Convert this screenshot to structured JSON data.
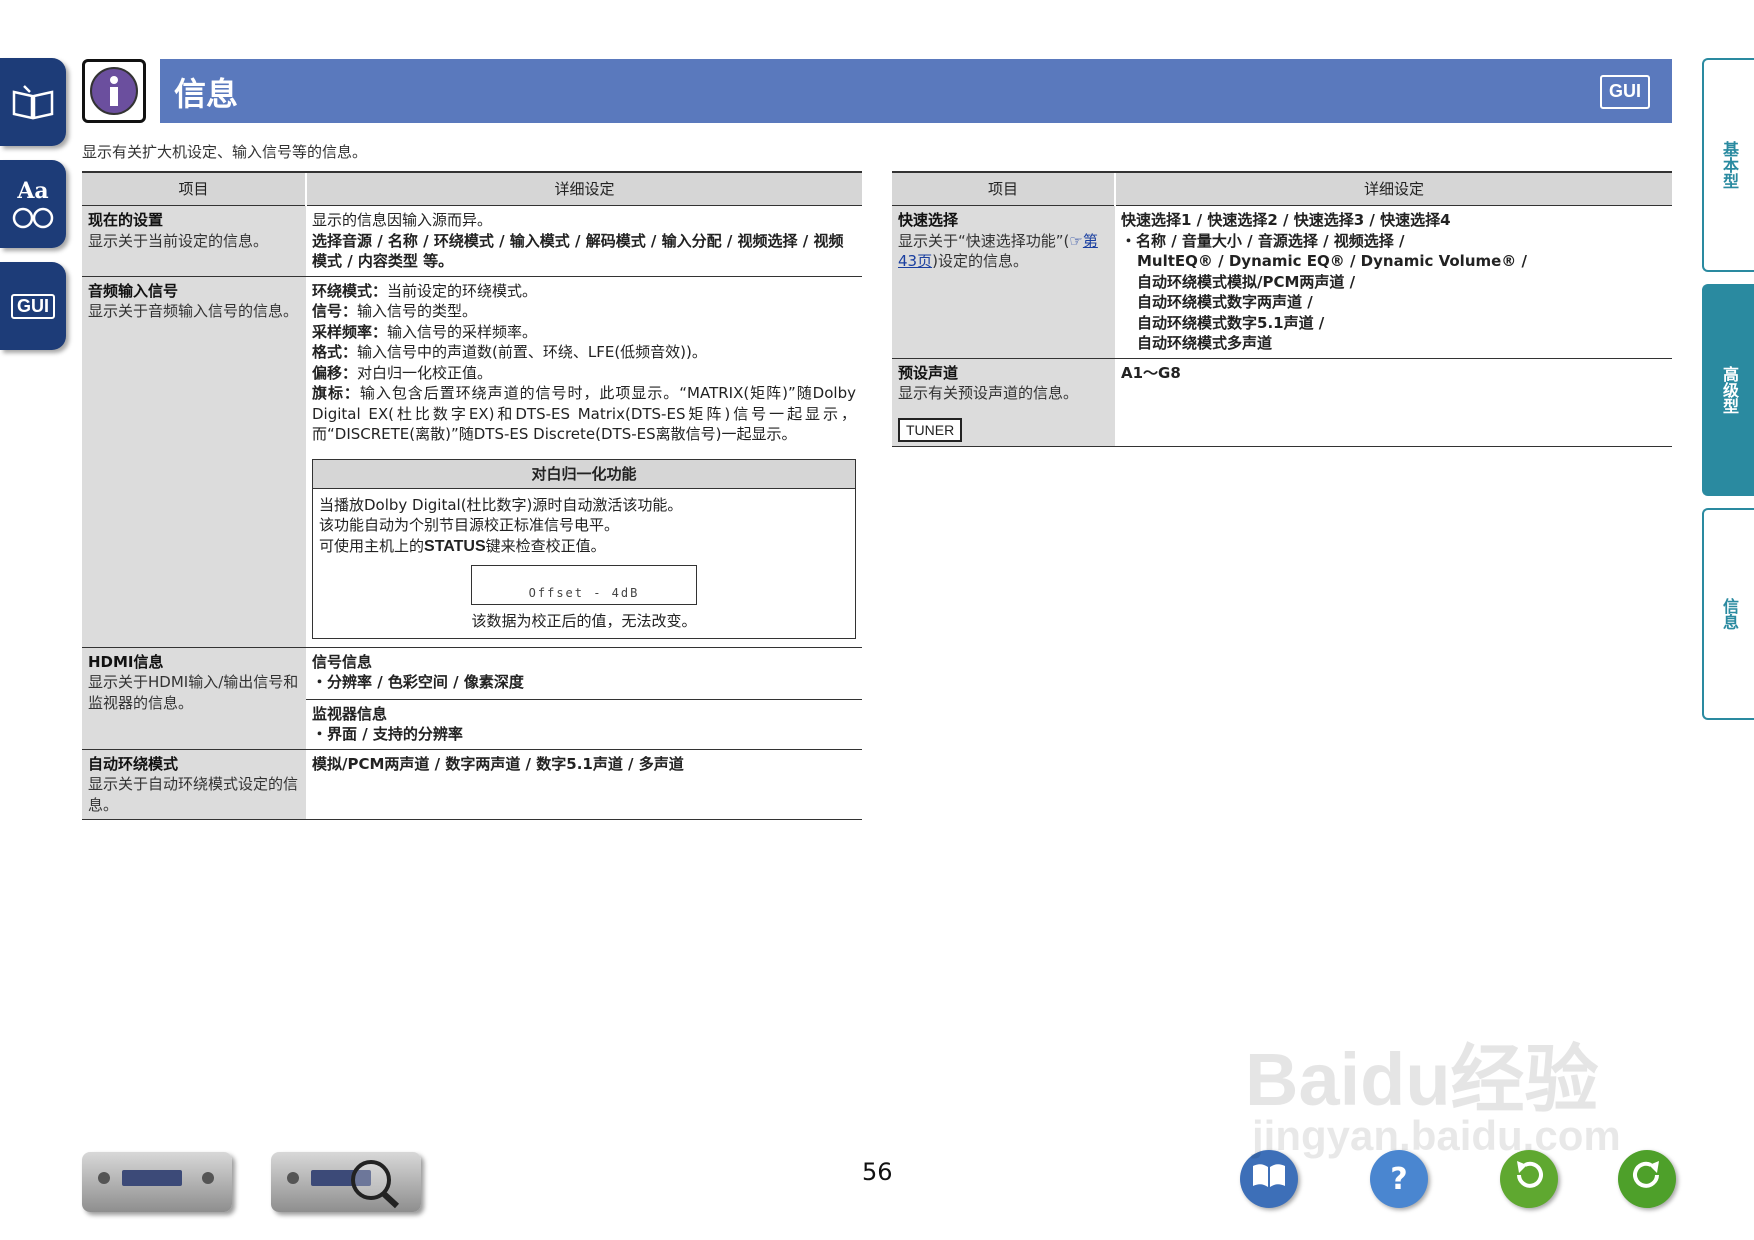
{
  "header": {
    "title": "信息",
    "gui_label": "GUI",
    "intro": "显示有关扩大机设定、输入信号等的信息。"
  },
  "left_tabs": [
    {
      "icon": "book-icon"
    },
    {
      "icon": "glossary-icon",
      "text": "Aa"
    },
    {
      "icon": "gui-icon",
      "text": "GUI"
    }
  ],
  "columns": {
    "item": "项目",
    "detail": "详细设定"
  },
  "left_table": {
    "rows": [
      {
        "name": "现在的设置",
        "desc": "显示关于当前设定的信息。",
        "detail_1": "显示的信息因输入源而异。",
        "detail_2": "选择音源 / 名称 / 环绕模式 / 输入模式 / 解码模式 / 输入分配 / 视频选择 / 视频模式 / 内容类型 等。"
      },
      {
        "name": "音频输入信号",
        "desc": "显示关于音频输入信号的信息。",
        "lines": [
          {
            "label": "环绕模式：",
            "text": "当前设定的环绕模式。"
          },
          {
            "label": "信号：",
            "text": "输入信号的类型。"
          },
          {
            "label": "采样频率：",
            "text": "输入信号的采样频率。"
          },
          {
            "label": "格式：",
            "text": "输入信号中的声道数(前置、环绕、LFE(低频音效))。"
          },
          {
            "label": "偏移：",
            "text": "对白归一化校正值。"
          },
          {
            "label": "旗标：",
            "text": "输入包含后置环绕声道的信号时，此项显示。“MATRIX(矩阵)”随Dolby Digital EX(杜比数字EX)和DTS-ES Matrix(DTS-ES矩阵)信号一起显示，而“DISCRETE(离散)”随DTS-ES Discrete(DTS-ES离散信号)一起显示。"
          }
        ],
        "dialogue_box": {
          "title": "对白归一化功能",
          "line_1": "当播放Dolby Digital(杜比数字)源时自动激活该功能。",
          "line_2": "该功能自动为个别节目源校正标准信号电平。",
          "line_3_pre": "可使用主机上的",
          "line_3_key": "STATUS",
          "line_3_post": "键来检查校正值。",
          "display_text": "Offset  - 4dB",
          "caption": "该数据为校正后的值，无法改变。"
        }
      },
      {
        "name": "HDMI信息",
        "desc": "显示关于HDMI输入/输出信号和监视器的信息。",
        "sub_1_title": "信号信息",
        "sub_1_items": "・分辨率 / 色彩空间 / 像素深度",
        "sub_2_title": "监视器信息",
        "sub_2_items": "・界面 / 支持的分辨率"
      },
      {
        "name": "自动环绕模式",
        "desc": "显示关于自动环绕模式设定的信息。",
        "detail": "模拟/PCM两声道 / 数字两声道 / 数字5.1声道 / 多声道"
      }
    ]
  },
  "right_table": {
    "rows": [
      {
        "name": "快速选择",
        "desc_pre": "显示关于“快速选择功能”(",
        "desc_link": "第43页",
        "desc_post": ")设定的信息。",
        "detail_lines": [
          "快速选择1 / 快速选择2 / 快速选择3 / 快速选择4",
          "・名称 / 音量大小 / 音源选择 / 视频选择 /",
          "MultEQ® / Dynamic EQ® / Dynamic Volume® /",
          "自动环绕模式模拟/PCM两声道 /",
          "自动环绕模式数字两声道 /",
          "自动环绕模式数字5.1声道 /",
          "自动环绕模式多声道"
        ]
      },
      {
        "name": "预设声道",
        "desc": "显示有关预设声道的信息。",
        "badge": "TUNER",
        "detail": "A1～G8"
      }
    ]
  },
  "right_tabs": [
    {
      "label": "基本型",
      "active": false
    },
    {
      "label": "高级型",
      "active": true
    },
    {
      "label": "信息",
      "active": false
    }
  ],
  "footer": {
    "page_number": "56",
    "buttons": [
      {
        "icon": "book-icon",
        "color": "#3d6fb8"
      },
      {
        "icon": "help-icon",
        "text": "?",
        "color": "#4a86d0"
      },
      {
        "icon": "back-icon",
        "color": "#5fa830"
      },
      {
        "icon": "forward-icon",
        "color": "#4ea02a"
      }
    ]
  },
  "watermark": {
    "main": "Baidu经验",
    "sub": "jingyan.baidu.com"
  }
}
